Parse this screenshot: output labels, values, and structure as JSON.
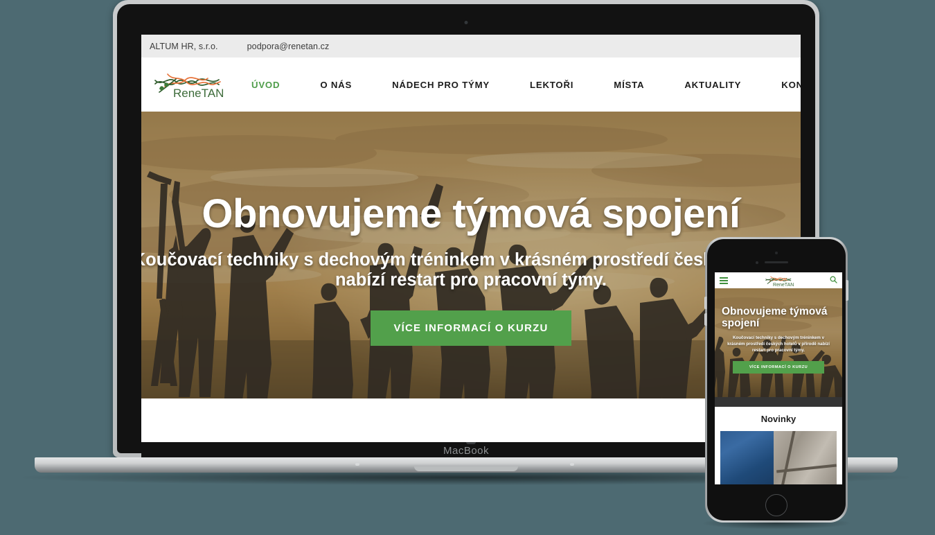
{
  "background_color": "#4d6a72",
  "accent_green": "#52a04b",
  "devices": {
    "laptop": {
      "name": "MacBook",
      "brand_label": "MacBook"
    },
    "phone": {
      "name": "iPhone"
    }
  },
  "website": {
    "topbar": {
      "company": "ALTUM HR, s.r.o.",
      "email": "podpora@renetan.cz"
    },
    "brand": {
      "name": "ReneTAN",
      "logo_colors": {
        "green": "#3d6b3a",
        "orange": "#e8733a"
      }
    },
    "nav": {
      "items": [
        {
          "label": "ÚVOD",
          "active": true
        },
        {
          "label": "O NÁS",
          "active": false
        },
        {
          "label": "NÁDECH PRO TÝMY",
          "active": false
        },
        {
          "label": "LEKTOŘI",
          "active": false
        },
        {
          "label": "MÍSTA",
          "active": false
        },
        {
          "label": "AKTUALITY",
          "active": false
        },
        {
          "label": "KONTAKT",
          "active": false
        }
      ],
      "search_icon": "search-icon"
    },
    "hero": {
      "title": "Obnovujeme týmová spojení",
      "subtitle_desktop": "Koučovací techniky s dechovým tréninkem v krásném prostředí českých přírodě nabízí restart pro pracovní týmy.",
      "subtitle_full": "Koučovací techniky s dechovým tréninkem v krásném prostředí českých hotelů v přírodě nabízí restart pro pracovní týmy.",
      "cta_label": "VÍCE INFORMACÍ O KURZU",
      "image_description": "silhouettes of a group of people with raised arms against a golden sunset sky"
    },
    "news": {
      "heading": "Novinky",
      "image_description": "close-up of blue denim fabric on stone paving"
    }
  }
}
